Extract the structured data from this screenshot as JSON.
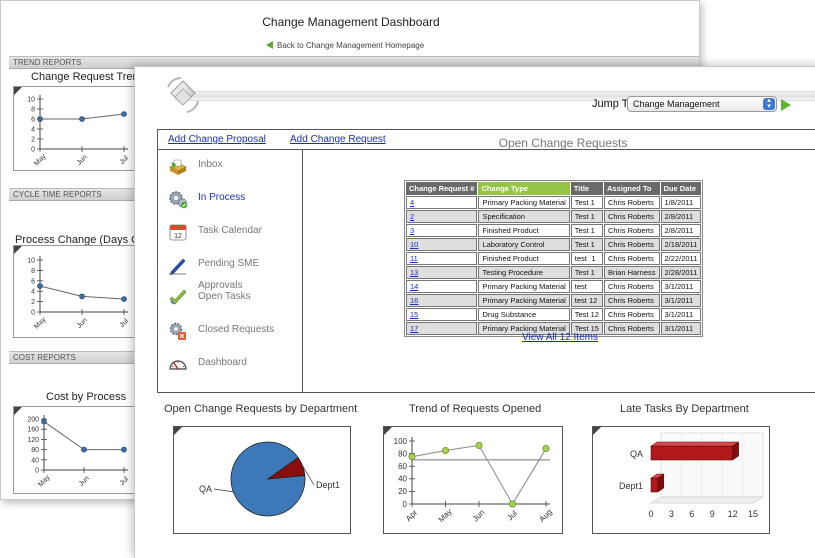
{
  "back": {
    "title": "Change Management Dashboard",
    "back_link": "Back to Change Management Homepage",
    "sections": [
      {
        "label": "TREND REPORTS",
        "chart_title": "Change Request Trend"
      },
      {
        "label": "CYCLE TIME REPORTS",
        "chart_title": "Process Change (Days Ove"
      },
      {
        "label": "COST REPORTS",
        "chart_title": "Cost by Process"
      }
    ]
  },
  "header": {
    "jump_label": "Jump To",
    "jump_value": "Change Management"
  },
  "links": {
    "add_proposal": "Add Change Proposal",
    "add_request": "Add Change Request"
  },
  "sidebar": {
    "items": [
      {
        "label": "Inbox",
        "icon": "inbox-icon"
      },
      {
        "label": "In Process",
        "icon": "gears-icon"
      },
      {
        "label": "Task Calendar",
        "icon": "calendar-icon"
      },
      {
        "label": "Pending SME Approvals",
        "icon": "pen-icon"
      },
      {
        "label": "Open Tasks",
        "icon": "checkmark-icon"
      },
      {
        "label": "Closed Requests",
        "icon": "closed-gears-icon"
      },
      {
        "label": "Dashboard",
        "icon": "gauge-icon"
      }
    ]
  },
  "open_requests": {
    "title": "Open Change Requests",
    "columns": [
      "Change Request #",
      "Change Type",
      "Title",
      "Assigned To",
      "Due Date"
    ],
    "rows": [
      [
        "4",
        "Primary Packing Material",
        "Test 1",
        "Chris Roberts",
        "1/8/2011"
      ],
      [
        "2",
        "Specification",
        "Test 1",
        "Chris Roberts",
        "2/8/2011"
      ],
      [
        "3",
        "Finished Product",
        "Test 1",
        "Chris Roberts",
        "2/8/2011"
      ],
      [
        "10",
        "Laboratory Control",
        "Test 1",
        "Chris Roberts",
        "2/18/2011"
      ],
      [
        "11",
        "Finished Product",
        "test `1",
        "Chris Roberts",
        "2/22/2011"
      ],
      [
        "13",
        "Testing Procedure",
        "Test 1",
        "Brian Harness",
        "2/28/2011"
      ],
      [
        "14",
        "Primary Packing Material",
        "test",
        "Chris Roberts",
        "3/1/2011"
      ],
      [
        "16",
        "Primary Packing Material",
        "test 12",
        "Chris Roberts",
        "3/1/2011"
      ],
      [
        "15",
        "Drug Substance",
        "Test 12",
        "Chris Roberts",
        "3/1/2011"
      ],
      [
        "17",
        "Primary Packing Material",
        "Test 15",
        "Chris Roberts",
        "3/1/2011"
      ]
    ],
    "view_all": "View All 12 Items"
  },
  "widgets": {
    "dept_title": "Open Change Requests by Department",
    "trend_title": "Trend of Requests Opened",
    "late_title": "Late Tasks By Department"
  },
  "chart_data": [
    {
      "type": "line",
      "title": "Change Request Trend",
      "x": [
        "May",
        "Jun",
        "Jul"
      ],
      "series": [
        {
          "values": [
            6,
            6,
            7
          ]
        }
      ],
      "yticks": [
        0,
        2,
        4,
        6,
        8,
        10
      ],
      "ylim": [
        0,
        10
      ]
    },
    {
      "type": "line",
      "title": "Process Change (Days Ove",
      "x": [
        "May",
        "Jun",
        "Jul"
      ],
      "series": [
        {
          "values": [
            5,
            3,
            2.5
          ]
        }
      ],
      "yticks": [
        0,
        2,
        4,
        6,
        8,
        10
      ],
      "ylim": [
        0,
        10
      ]
    },
    {
      "type": "line",
      "title": "Cost by Process",
      "x": [
        "May",
        "Jun",
        "Jul"
      ],
      "series": [
        {
          "values": [
            190,
            80,
            80
          ]
        }
      ],
      "yticks": [
        0,
        40,
        80,
        120,
        160,
        200
      ],
      "ylim": [
        0,
        200
      ]
    },
    {
      "type": "pie",
      "title": "Open Change Requests by Department",
      "categories": [
        "QA",
        "Dept1"
      ],
      "values": [
        11,
        1
      ],
      "colors": [
        "#3d79b8",
        "#8b0d0d"
      ]
    },
    {
      "type": "line",
      "title": "Trend of Requests Opened",
      "x": [
        "Apr",
        "May",
        "Jun",
        "Jul",
        "Aug"
      ],
      "series": [
        {
          "values": [
            75,
            85,
            93,
            0,
            88
          ]
        }
      ],
      "yticks": [
        0,
        20,
        40,
        60,
        80,
        100
      ],
      "ylim": [
        0,
        100
      ],
      "reference_line": 70
    },
    {
      "type": "bar",
      "orientation": "horizontal",
      "title": "Late Tasks By Department",
      "categories": [
        "QA",
        "Dept1"
      ],
      "values": [
        12,
        1
      ],
      "xticks": [
        0,
        3,
        6,
        9,
        12,
        15
      ],
      "xlim": [
        0,
        15
      ],
      "color": "#b0181b"
    }
  ]
}
